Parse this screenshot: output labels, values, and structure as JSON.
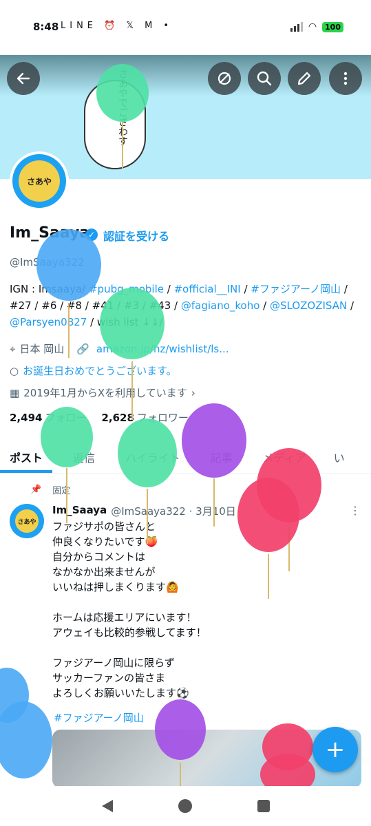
{
  "status": {
    "time": "8:48",
    "icons": "LINE ⏰ 𝕏 M •",
    "battery": "100"
  },
  "banner": {
    "speech_text": "さあやでござわす"
  },
  "avatar": {
    "label": "さあや"
  },
  "profile": {
    "name": "Im_Saaya",
    "verify_link": "認証を受ける",
    "handle": "@ImSaaya322"
  },
  "bio": {
    "line1_prefix": "IGN : Imsaaya/ ",
    "tag_pubg": "#pubg_mobile",
    "sep1": " / ",
    "tag_ini": "#official__INI",
    "sep2": " / ",
    "tag_fagiano": "#ファジアーノ岡山",
    "line2_mid": " / #27 / #6 / #8 / #41 / #3 / #43 / ",
    "mention_koho": "@fagiano_koho",
    "sep3": " / ",
    "mention_sloz": "@SLOZOZISAN",
    "sep4": " / ",
    "mention_pars": "@Parsyen0827",
    "tail": " / wish list ↓↓/"
  },
  "meta": {
    "location": "日本 岡山",
    "website": "amazon.jp/hz/wishlist/ls...",
    "birthday": "お誕生日おめでとうございます。",
    "joined": "2019年1月からXを利用しています"
  },
  "follow": {
    "following_count": "2,494",
    "following_label": "フォロー",
    "followers_count": "2,628",
    "followers_label": "フォロワー"
  },
  "tabs": [
    "ポスト",
    "返信",
    "ハイライト",
    "記事",
    "メディア",
    "い"
  ],
  "post": {
    "pinned_label": "固定",
    "author": "Im_Saaya",
    "handle_date": "@ImSaaya322 · 3月10日",
    "body": "ファジサポの皆さんと\n仲良くなりたいです🍑\n自分からコメントは\nなかなか出来ませんが\nいいねは押しまくります🙆\n\nホームは応援エリアにいます！\nアウェイも比較的参戦してます！\n\nファジアーノ岡山に限らず\nサッカーファンの皆さま\nよろしくお願いいたします⚽",
    "hashtag": "#ファジアーノ岡山"
  },
  "fab_label": "+",
  "icons": {
    "back": "arrow-left-icon",
    "hide": "eye-slash-icon",
    "search": "search-icon",
    "edit": "pencil-icon",
    "more": "more-vertical-icon"
  },
  "colors": {
    "accent": "#1d9bf0",
    "banner": "#b7ecfa",
    "balloon_green": "#4ee0a4",
    "balloon_blue": "#4aa8f5",
    "balloon_purple": "#a450e6",
    "balloon_pink": "#f2406a"
  }
}
